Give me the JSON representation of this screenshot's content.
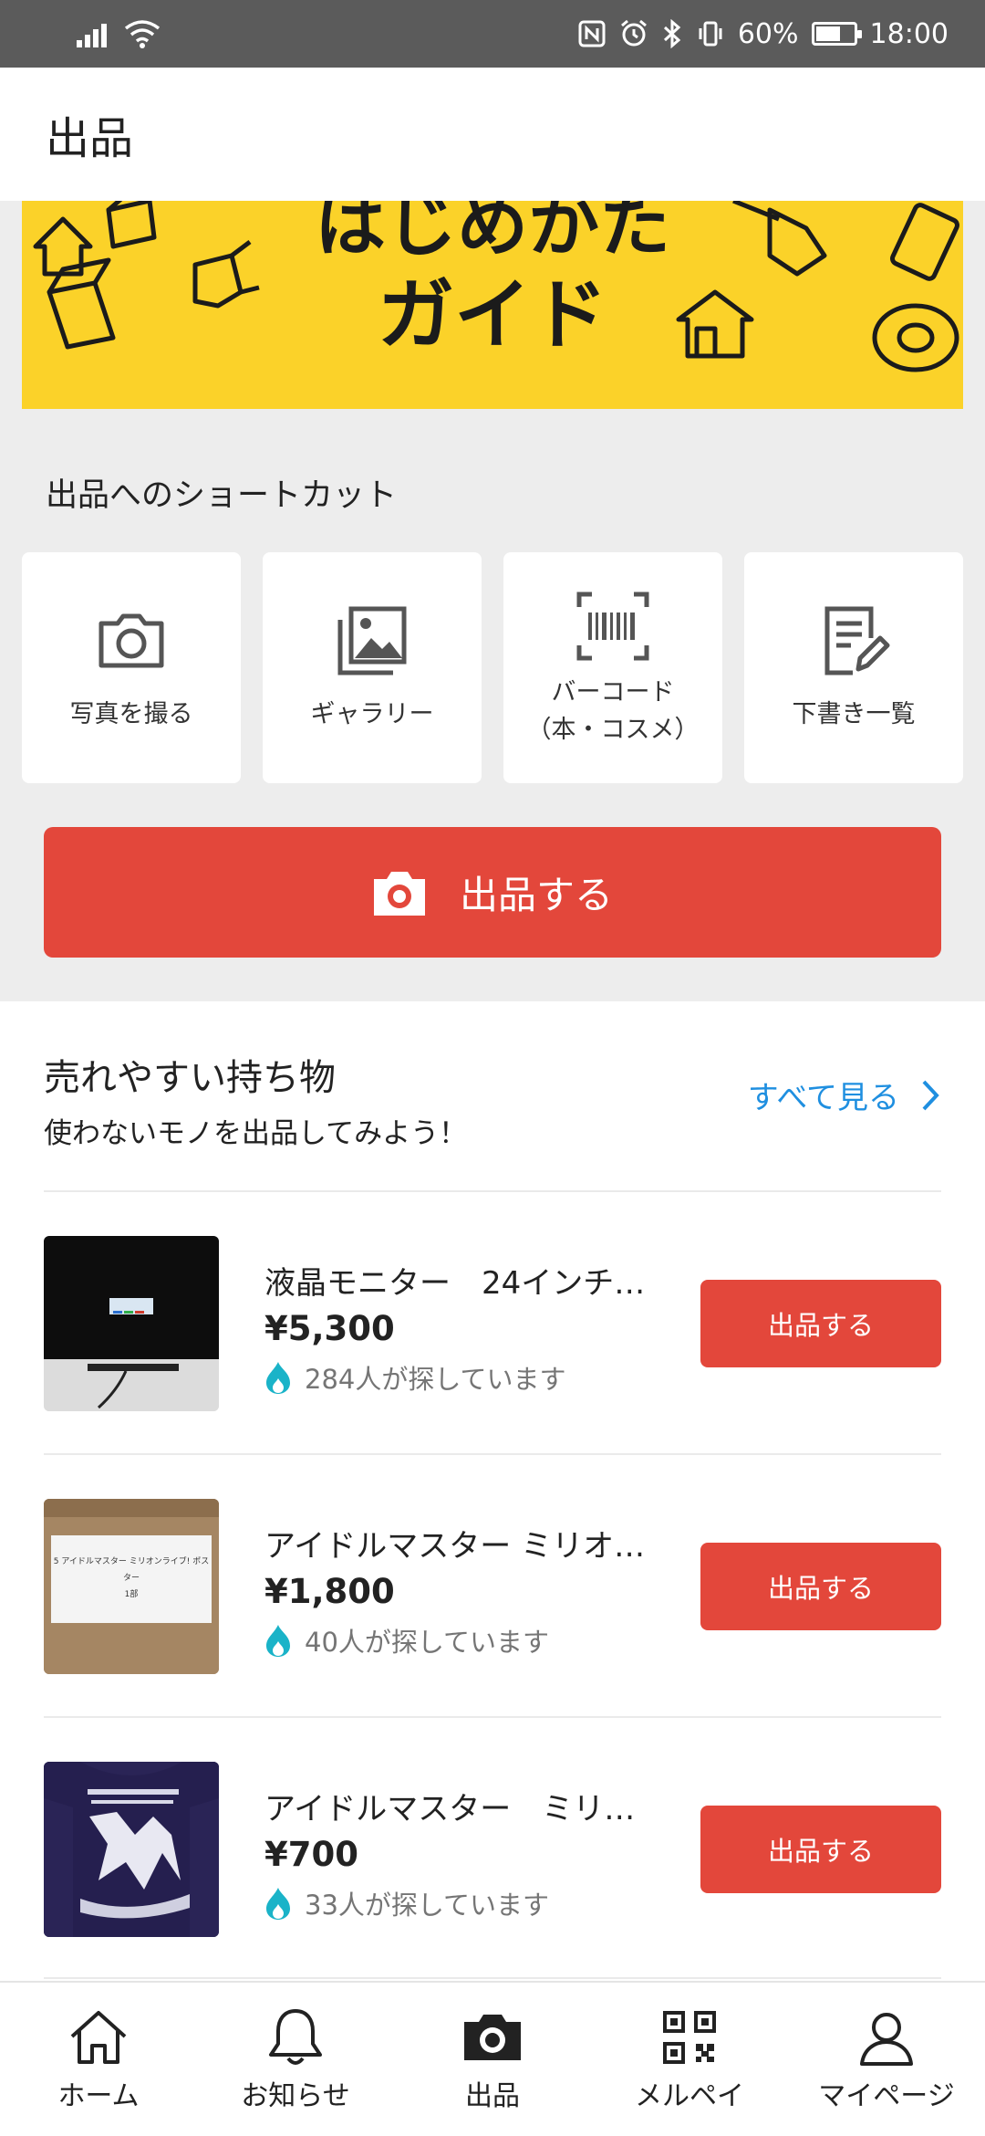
{
  "status_bar": {
    "battery": "60%",
    "battery_level": 0.6,
    "time": "18:00"
  },
  "header": {
    "title": "出品"
  },
  "banner": {
    "line1": "はじめかた",
    "line2": "ガイド"
  },
  "shortcuts": {
    "title": "出品へのショートカット",
    "items": [
      {
        "label": "写真を撮る",
        "icon": "camera-icon"
      },
      {
        "label": "ギャラリー",
        "icon": "gallery-icon"
      },
      {
        "label": "バーコード\n（本・コスメ）",
        "icon": "barcode-icon"
      },
      {
        "label": "下書き一覧",
        "icon": "draft-list-icon"
      }
    ]
  },
  "cta": {
    "label": "出品する"
  },
  "sellable": {
    "title": "売れやすい持ち物",
    "subtitle": "使わないモノを出品してみよう！",
    "see_all": "すべて見る",
    "items": [
      {
        "name": "液晶モニター　24インチ…",
        "price": "¥5,300",
        "searching": "284人が探しています",
        "button": "出品する"
      },
      {
        "name": "アイドルマスター ミリオ…",
        "price": "¥1,800",
        "searching": "40人が探しています",
        "button": "出品する",
        "thumb_text": "5 アイドルマスター ミリオンライブ! ポスター\n1部"
      },
      {
        "name": "アイドルマスター　ミリ…",
        "price": "¥700",
        "searching": "33人が探しています",
        "button": "出品する"
      }
    ]
  },
  "bottom_nav": {
    "items": [
      {
        "label": "ホーム",
        "icon": "home-icon"
      },
      {
        "label": "お知らせ",
        "icon": "bell-icon"
      },
      {
        "label": "出品",
        "icon": "camera-icon"
      },
      {
        "label": "メルペイ",
        "icon": "qr-code-icon"
      },
      {
        "label": "マイページ",
        "icon": "person-icon"
      }
    ]
  },
  "colors": {
    "accent": "#e3473b",
    "link": "#1f8fe0",
    "banner": "#fbd229",
    "flame": "#1ab3c8"
  }
}
